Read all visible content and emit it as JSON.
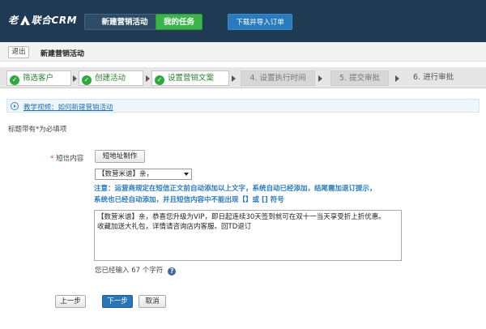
{
  "header": {
    "logo_text_left": "老",
    "logo_text_right": "联合CRM",
    "nav": {
      "new_campaign": "新建营销活动",
      "my_tasks": "我的任务",
      "download_import": "下载并导入订单"
    }
  },
  "subbar": {
    "exit_label": "退出",
    "page_title": "新建营销活动"
  },
  "steps": [
    {
      "label": "筛选客户",
      "state": "done"
    },
    {
      "label": "创建活动",
      "state": "done"
    },
    {
      "label": "设置营销文案",
      "state": "current"
    },
    {
      "label": "4. 设置执行时间",
      "state": "todo"
    },
    {
      "label": "5. 提交审批",
      "state": "todo"
    },
    {
      "label": "6. 进行审批",
      "state": "todo"
    }
  ],
  "tutorial_link": "教学视频：如何新建营销活动",
  "required_note": "标题带有*为必填项",
  "form": {
    "sms_label": "短信内容",
    "short_url_button": "短地址制作",
    "signature_select": "【数营米谱】亲，",
    "notice_line1": "注意：运营商规定在短信正文前自动添加以上文字，系统自动已经添加，结尾需加退订提示，",
    "notice_line2": "系统也已经自动添加，并且短信内容中不能出现【】或 [] 符号",
    "message_line1": "【数营米谱】亲，恭喜您升级为VIP，即日起连续30天签到就可在双十一当天享受折上折优惠。",
    "message_line2": "收藏加送大礼包，详情请咨询店内客服。回TD退订",
    "char_count": "您已经输入 67 个字符",
    "help_glyph": "?"
  },
  "buttons": {
    "prev": "上一步",
    "next": "下一步",
    "cancel": "取消"
  },
  "colors": {
    "header_bg": "#1f3b53",
    "tasks_green": "#3bb54a",
    "import_blue": "#2a7bbd",
    "step_done_green": "#2fa93e",
    "notice_blue": "#2a7bbd",
    "next_btn_blue": "#2b74b8"
  }
}
